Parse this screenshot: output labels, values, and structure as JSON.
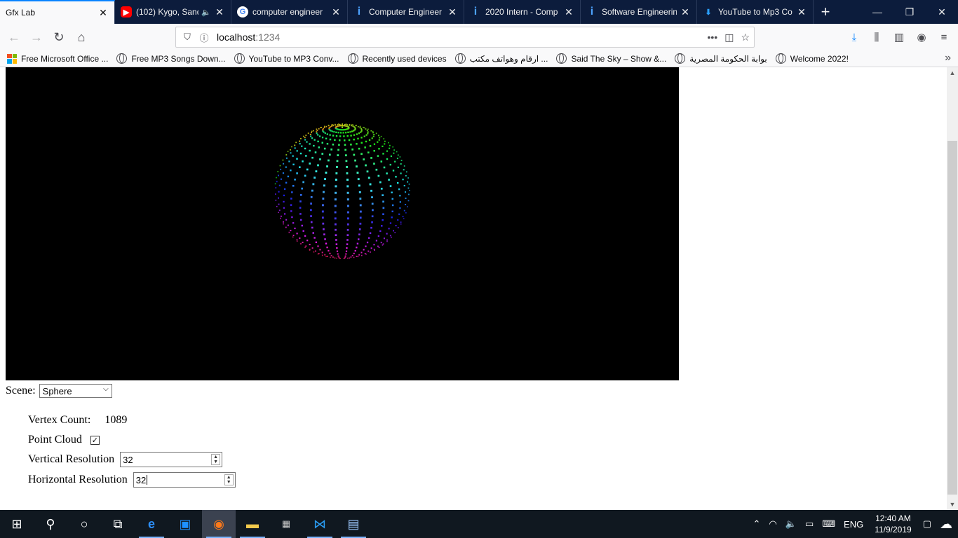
{
  "browser": {
    "tabs": [
      {
        "title": "Gfx Lab",
        "favicon": "none",
        "active": true
      },
      {
        "title": "(102) Kygo, Sand",
        "favicon": "youtube-icon",
        "audio": true
      },
      {
        "title": "computer engineer",
        "favicon": "google-icon"
      },
      {
        "title": "Computer Engineer",
        "favicon": "indeed-icon"
      },
      {
        "title": "2020 Intern - Comp",
        "favicon": "indeed-icon"
      },
      {
        "title": "Software Engineerin",
        "favicon": "indeed-icon"
      },
      {
        "title": "YouTube to Mp3 Co",
        "favicon": "download-icon"
      }
    ],
    "url_host": "localhost",
    "url_port": ":1234",
    "bookmarks": [
      {
        "label": "Free Microsoft Office ...",
        "icon": "microsoft-icon"
      },
      {
        "label": "Free MP3 Songs Down...",
        "icon": "globe-icon"
      },
      {
        "label": "YouTube to MP3 Conv...",
        "icon": "globe-icon"
      },
      {
        "label": "Recently used devices",
        "icon": "globe-icon"
      },
      {
        "label": "ارقام وهواتف مكتب ...",
        "icon": "globe-icon"
      },
      {
        "label": "Said The Sky – Show &...",
        "icon": "globe-icon"
      },
      {
        "label": "بوابة الحكومة المصرية",
        "icon": "globe-icon"
      },
      {
        "label": "Welcome 2022!",
        "icon": "globe-icon"
      }
    ]
  },
  "page": {
    "scene_label": "Scene:",
    "scene_value": "Sphere",
    "vertex_count_label": "Vertex Count:",
    "vertex_count_value": "1089",
    "point_cloud_label": "Point Cloud",
    "point_cloud_checked": true,
    "vertical_resolution_label": "Vertical Resolution",
    "vertical_resolution_value": "32",
    "horizontal_resolution_label": "Horizontal Resolution",
    "horizontal_resolution_value": "32"
  },
  "taskbar": {
    "language": "ENG",
    "time": "12:40 AM",
    "date": "11/9/2019"
  }
}
